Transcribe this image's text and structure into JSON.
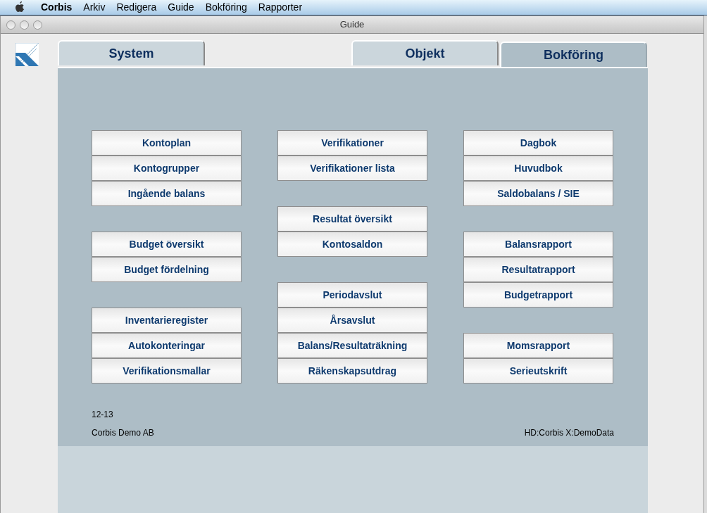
{
  "menu_bar": {
    "app": "Corbis",
    "items": [
      "Arkiv",
      "Redigera",
      "Guide",
      "Bokföring",
      "Rapporter"
    ]
  },
  "window": {
    "title": "Guide"
  },
  "tabs": [
    {
      "label": "System",
      "selected": false
    },
    {
      "label": "Objekt",
      "selected": false
    },
    {
      "label": "Bokföring",
      "selected": true
    }
  ],
  "button_columns": [
    [
      [
        "Kontoplan",
        "Kontogrupper",
        "Ingående balans"
      ],
      [
        "Budget översikt",
        "Budget fördelning"
      ],
      [
        "Inventarieregister",
        "Autokonteringar",
        "Verifikationsmallar"
      ]
    ],
    [
      [
        "Verifikationer",
        "Verifikationer lista"
      ],
      [
        "Resultat översikt",
        "Kontosaldon"
      ],
      [
        "Periodavslut",
        "Årsavslut",
        "Balans/Resultaträkning",
        "Räkenskapsutdrag"
      ]
    ],
    [
      [
        "Dagbok",
        "Huvudbok",
        "Saldobalans / SIE"
      ],
      [
        "Balansrapport",
        "Resultatrapport",
        "Budgetrapport"
      ],
      [
        "Momsrapport",
        "Serieutskrift"
      ]
    ]
  ],
  "footer": {
    "period": "12-13",
    "company": "Corbis Demo AB",
    "database": "HD:Corbis X:DemoData"
  }
}
